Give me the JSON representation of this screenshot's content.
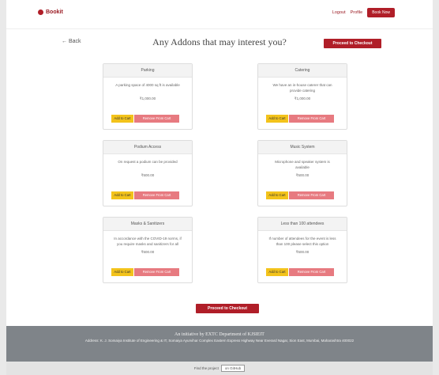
{
  "navbar": {
    "brand": "Bookit",
    "links": [
      "Logout",
      "Profile"
    ],
    "book_now": "Book Now"
  },
  "header": {
    "back": "Back",
    "title": "Any Addons that may interest you?",
    "checkout_button": "Proceed to Checkout"
  },
  "addons": [
    {
      "name": "Parking",
      "description": "A parking space of 4000 sq ft is available",
      "price": "₹1,000.00",
      "add": "Add to Cart",
      "remove": "Remove From Cart"
    },
    {
      "name": "Catering",
      "description": "We have an in-house caterer that can provide catering",
      "price": "₹1,000.00",
      "add": "Add to Cart",
      "remove": "Remove From Cart"
    },
    {
      "name": "Podium Access",
      "description": "On request a podium can be provided",
      "price": "₹500.00",
      "add": "Add to Cart",
      "remove": "Remove From Cart"
    },
    {
      "name": "Music System",
      "description": "Microphone and speaker system is available",
      "price": "₹500.00",
      "add": "Add to Cart",
      "remove": "Remove From Cart"
    },
    {
      "name": "Masks & Sanitizers",
      "description": "In accordance with the COVID-19 norms, if you require masks and sanitizers for all",
      "price": "₹500.00",
      "add": "Add to Cart",
      "remove": "Remove From Cart"
    },
    {
      "name": "Less than 100 attendees",
      "description": "If number of attendees for the event is less than 100 please select this option",
      "price": "₹500.00",
      "add": "Add to Cart",
      "remove": "Remove From Cart"
    }
  ],
  "bottom_checkout": "Proceed to Checkout",
  "footer": {
    "title": "An initiative by EXTC Department of KJSIEIT",
    "address": "Address: K. J. Somaiya Institute of Engineering & IT, Somaiya Ayurvihar Complex Eastern Express Highway Near Everard Nagar, Sion East, Mumbai, Maharashtra 400022",
    "find_project": "Find the project",
    "github": "on GitHub"
  },
  "colors": {
    "primary": "#b01e28",
    "add_button": "#f3c31b",
    "remove_button": "#e77a80",
    "footer": "#7f8489"
  }
}
